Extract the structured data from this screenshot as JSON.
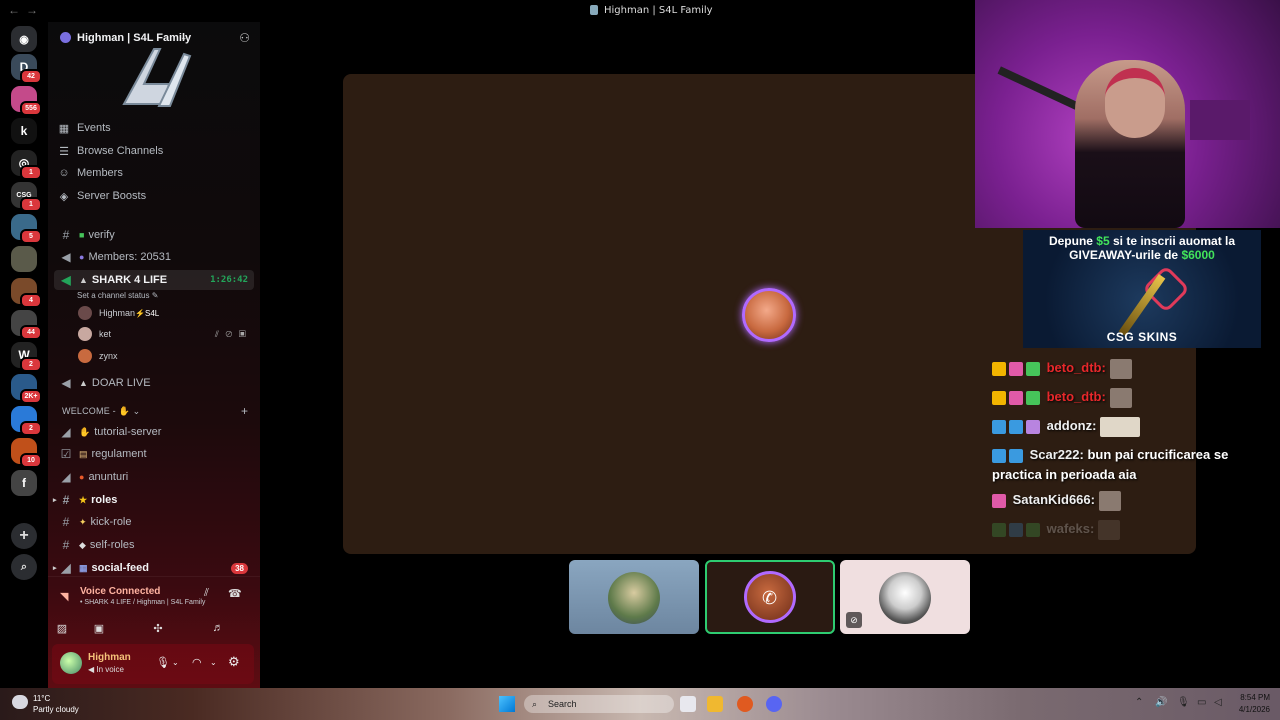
{
  "window": {
    "title": "Highman | S4L Family"
  },
  "servers": [
    {
      "badge": "42",
      "color": "#3a4a5a",
      "glyph": "D"
    },
    {
      "badge": "556",
      "color": "#c44a8a",
      "glyph": ""
    },
    {
      "badge": "",
      "color": "#111",
      "glyph": "k"
    },
    {
      "badge": "1",
      "color": "#222",
      "glyph": "◎"
    },
    {
      "badge": "1",
      "color": "#333",
      "glyph": "CSG"
    },
    {
      "badge": "5",
      "color": "#3a6a8a",
      "glyph": ""
    },
    {
      "badge": "",
      "color": "#5a5a4a",
      "glyph": ""
    },
    {
      "badge": "4",
      "color": "#7a4a2a",
      "glyph": ""
    },
    {
      "badge": "44",
      "color": "#444",
      "glyph": ""
    },
    {
      "badge": "2",
      "color": "#222",
      "glyph": "W"
    },
    {
      "badge": "2K+",
      "color": "#2a5a8a",
      "glyph": ""
    },
    {
      "badge": "2",
      "color": "#2a7ad8",
      "glyph": ""
    },
    {
      "badge": "10",
      "color": "#c0501a",
      "glyph": ""
    },
    {
      "badge": "",
      "color": "#444",
      "glyph": "f"
    }
  ],
  "guild": {
    "name": "Highman | S4L Family"
  },
  "nav": {
    "events": "Events",
    "browse": "Browse Channels",
    "members": "Members",
    "boosts": "Server Boosts"
  },
  "channels": {
    "verify": "verify",
    "members_count": "Members: 20531",
    "shark": "SHARK 4 LIFE",
    "shark_timer": "1:26:42",
    "shark_status": "Set a channel status",
    "doar_live": "DOAR LIVE",
    "category_welcome": "WELCOME -",
    "tutorial": "tutorial-server",
    "regulament": "regulament",
    "anunturi": "anunturi",
    "roles": "roles",
    "kick_role": "kick-role",
    "self_roles": "self-roles",
    "social_feed": "social-feed",
    "social_feed_badge": "38"
  },
  "voice_users": [
    {
      "name": "Highman",
      "tag": "S4L",
      "color": "#6a4a4a"
    },
    {
      "name": "ket",
      "tag": "",
      "color": "#c8a8a0"
    },
    {
      "name": "zynx",
      "tag": "",
      "color": "#c86a3f"
    }
  ],
  "voice": {
    "title": "Voice Connected",
    "sub": "SHARK 4 LIFE / Highman | S4L Family"
  },
  "user": {
    "name": "Highman",
    "status": "In voice"
  },
  "ad": {
    "line1_pre": "Depune ",
    "line1_amt": "$5",
    "line1_post": " si te inscrii auomat la",
    "line2_pre": "GIVEAWAY-urile de ",
    "line2_amt": "$6000",
    "brand": "CSG SKINS"
  },
  "chat": [
    {
      "user": "beto_dtb:",
      "text": "",
      "badges": [
        "crown",
        "pink",
        "green"
      ],
      "emote": true,
      "red": true
    },
    {
      "user": "beto_dtb:",
      "text": "",
      "badges": [
        "crown",
        "pink",
        "green"
      ],
      "emote": true,
      "red": true
    },
    {
      "user": "addonz:",
      "text": "",
      "badges": [
        "blue",
        "blue",
        "purple"
      ],
      "emote": true,
      "wide": true,
      "red": false
    },
    {
      "user": "Scar222:",
      "text": "bun pai crucificarea se practica in perioada aia",
      "badges": [
        "blue",
        "blue"
      ],
      "emote": false,
      "red": false
    },
    {
      "user": "SatanKid666:",
      "text": "",
      "badges": [
        "pink"
      ],
      "emote": true,
      "red": false
    },
    {
      "user": "wafeks:",
      "text": "",
      "badges": [
        "green",
        "blue",
        "green"
      ],
      "emote": true,
      "red": false,
      "fade": true
    }
  ],
  "taskbar": {
    "temp": "11°C",
    "condition": "Partly cloudy",
    "search": "Search",
    "time": "8:54 PM",
    "date": "4/1/2026"
  },
  "colors": {
    "speaking_ring": "#b06aff",
    "connected": "#23a55a",
    "badge_red": "#da373c"
  }
}
